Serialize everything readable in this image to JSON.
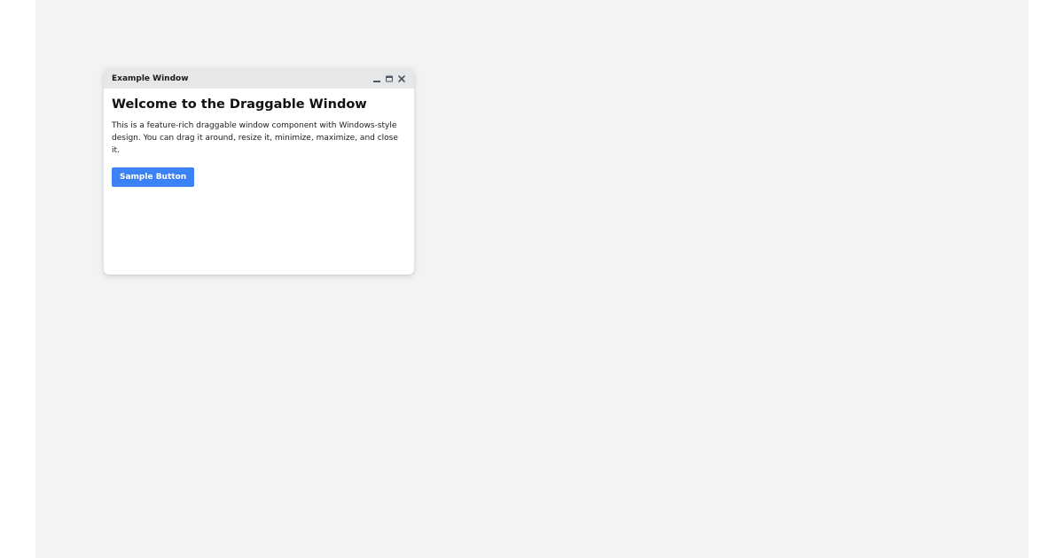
{
  "window": {
    "title": "Example Window",
    "controls": {
      "minimize_icon": "minimize-icon",
      "maximize_icon": "maximize-icon",
      "close_icon": "close-icon"
    }
  },
  "content": {
    "heading": "Welcome to the Draggable Window",
    "paragraph": "This is a feature-rich draggable window component with Windows-style design. You can drag it around, resize it, minimize, maximize, and close it.",
    "button_label": "Sample Button"
  },
  "colors": {
    "desktop_background": "#f2f3f5",
    "titlebar_background": "#e6e7e9",
    "button_primary": "#3b82f6",
    "icon_color": "#4b5563"
  }
}
